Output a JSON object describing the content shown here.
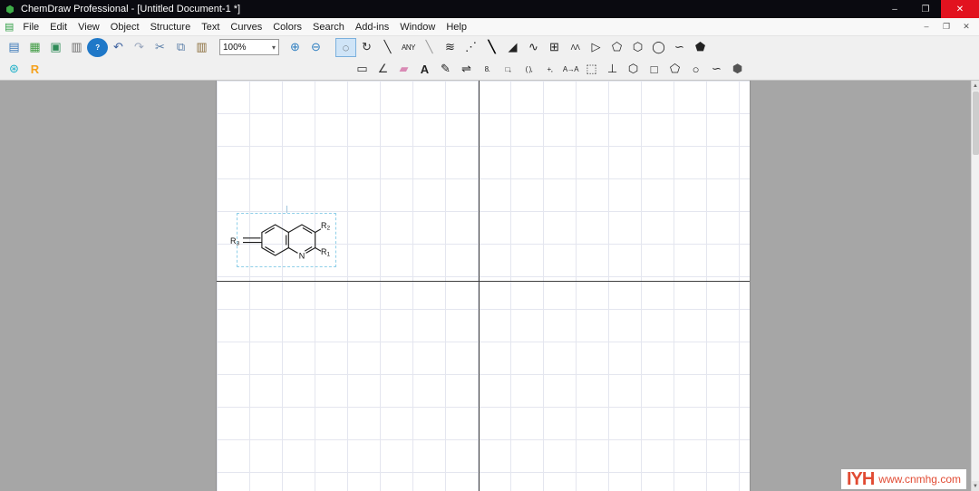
{
  "window": {
    "app_icon": "⬢",
    "title": "ChemDraw Professional - [Untitled Document-1 *]",
    "controls": {
      "minimize": "–",
      "maximize": "❐",
      "close": "✕"
    }
  },
  "menubar": {
    "doc_icon": "▤",
    "items": [
      {
        "name": "menu-file",
        "label": "File"
      },
      {
        "name": "menu-edit",
        "label": "Edit"
      },
      {
        "name": "menu-view",
        "label": "View"
      },
      {
        "name": "menu-object",
        "label": "Object"
      },
      {
        "name": "menu-structure",
        "label": "Structure"
      },
      {
        "name": "menu-text",
        "label": "Text"
      },
      {
        "name": "menu-curves",
        "label": "Curves"
      },
      {
        "name": "menu-colors",
        "label": "Colors"
      },
      {
        "name": "menu-search",
        "label": "Search"
      },
      {
        "name": "menu-addins",
        "label": "Add-ins"
      },
      {
        "name": "menu-window",
        "label": "Window"
      },
      {
        "name": "menu-help",
        "label": "Help"
      }
    ],
    "doc_controls": {
      "minimize": "–",
      "restore": "❐",
      "close": "✕"
    }
  },
  "toolbar": {
    "file_items": [
      {
        "name": "new-document-icon",
        "glyph": "▤",
        "color": "#3a77b8"
      },
      {
        "name": "open-icon",
        "glyph": "▦",
        "color": "#3f9b43"
      },
      {
        "name": "save-icon",
        "glyph": "▣",
        "color": "#2e8b57"
      },
      {
        "name": "print-icon",
        "glyph": "▥",
        "color": "#6f6f6f"
      },
      {
        "name": "help-icon",
        "glyph": "?",
        "color": "#ffffff",
        "bg": "#1f78c8",
        "small": true,
        "bold": true
      },
      {
        "name": "undo-icon",
        "glyph": "↶",
        "color": "#3a5f9e"
      },
      {
        "name": "redo-icon",
        "glyph": "↷",
        "color": "#9aa7bd"
      },
      {
        "name": "cut-icon",
        "glyph": "✂",
        "color": "#5a7ea8"
      },
      {
        "name": "copy-icon",
        "glyph": "⧉",
        "color": "#5a7ea8"
      },
      {
        "name": "paste-icon",
        "glyph": "▥",
        "color": "#8a6d3b"
      }
    ],
    "zoom": {
      "value": "100%",
      "dropdown": "▾"
    },
    "zoom_items": [
      {
        "name": "zoom-in-icon",
        "glyph": "⊕",
        "color": "#2f7fc1"
      },
      {
        "name": "zoom-out-icon",
        "glyph": "⊖",
        "color": "#2f7fc1"
      }
    ],
    "tool_items": [
      {
        "name": "lasso-tool-icon",
        "glyph": "◌",
        "color": "#333333",
        "selected": true
      },
      {
        "name": "rotate-tool-icon",
        "glyph": "↻",
        "color": "#333333"
      },
      {
        "name": "solid-bond-icon",
        "glyph": "╲",
        "color": "#222222"
      },
      {
        "name": "any-bond-icon",
        "glyph": "ANY",
        "color": "#222222",
        "small": true
      },
      {
        "name": "dashed-bond-icon",
        "glyph": "╲",
        "color": "#999999"
      },
      {
        "name": "hashed-bond-icon",
        "glyph": "≋",
        "color": "#222222"
      },
      {
        "name": "hashed-wedge-icon",
        "glyph": "⋰",
        "color": "#222222"
      },
      {
        "name": "bold-bond-icon",
        "glyph": "╲",
        "color": "#000000",
        "bold": true
      },
      {
        "name": "wedge-bond-icon",
        "glyph": "◢",
        "color": "#222222"
      },
      {
        "name": "wavy-bond-icon",
        "glyph": "∿",
        "color": "#222222"
      },
      {
        "name": "table-tool-icon",
        "glyph": "⊞",
        "color": "#222222"
      },
      {
        "name": "chain-tool-icon",
        "glyph": "ΛΛ",
        "color": "#222222",
        "small": true
      },
      {
        "name": "arrow-tool-icon",
        "glyph": "▷",
        "color": "#222222"
      },
      {
        "name": "cyclopentane-tool-icon",
        "glyph": "⬠",
        "color": "#222222"
      },
      {
        "name": "cyclohexane-tool-icon",
        "glyph": "⬡",
        "color": "#222222"
      },
      {
        "name": "benzene-tool-icon",
        "glyph": "◯",
        "color": "#222222"
      },
      {
        "name": "curved-arrow-tool-icon",
        "glyph": "∽",
        "color": "#222222"
      },
      {
        "name": "templates-tool-icon",
        "glyph": "⬟",
        "color": "#222222"
      }
    ],
    "side_items": [
      {
        "name": "addin-swirl-icon",
        "glyph": "⊛",
        "color": "#1fb0c8"
      },
      {
        "name": "r-group-icon",
        "glyph": "R",
        "color": "#f5a11c",
        "bold": true
      }
    ],
    "tool_items2": [
      {
        "name": "marquee-tool-icon",
        "glyph": "▭",
        "color": "#333333"
      },
      {
        "name": "angle-tool-icon",
        "glyph": "∠",
        "color": "#333333"
      },
      {
        "name": "eraser-tool-icon",
        "glyph": "▰",
        "color": "#d98ab5"
      },
      {
        "name": "text-tool-icon",
        "glyph": "A",
        "color": "#222222",
        "bold": true
      },
      {
        "name": "pen-tool-icon",
        "glyph": "✎",
        "color": "#222222"
      },
      {
        "name": "arrows-tool-icon",
        "glyph": "⇌",
        "color": "#222222"
      },
      {
        "name": "orbitals-tool-icon",
        "glyph": "8.",
        "color": "#222222",
        "small": true
      },
      {
        "name": "shapes-tool-icon",
        "glyph": "□,",
        "color": "#222222",
        "small": true
      },
      {
        "name": "brackets-tool-icon",
        "glyph": "( ),",
        "color": "#222222",
        "small": true
      },
      {
        "name": "plus-tool-icon",
        "glyph": "+,",
        "color": "#222222",
        "small": true
      },
      {
        "name": "reaction-map-tool-icon",
        "glyph": "A→A",
        "color": "#222222",
        "small": true
      },
      {
        "name": "frame-tool-icon",
        "glyph": "⬚",
        "color": "#222222"
      },
      {
        "name": "tlc-plate-tool-icon",
        "glyph": "⊥",
        "color": "#222222"
      },
      {
        "name": "hexagon-template-icon",
        "glyph": "⬡",
        "color": "#222222"
      },
      {
        "name": "square-template-icon",
        "glyph": "□",
        "color": "#222222"
      },
      {
        "name": "pentagon-template-icon",
        "glyph": "⬠",
        "color": "#222222"
      },
      {
        "name": "circle-template-icon",
        "glyph": "○",
        "color": "#222222"
      },
      {
        "name": "curve-template-icon",
        "glyph": "∽",
        "color": "#222222"
      },
      {
        "name": "chair-template-icon",
        "glyph": "⬢",
        "color": "#555555"
      }
    ]
  },
  "canvas": {
    "structure": {
      "atom_n": "N",
      "r1_base": "R",
      "r1_sub": "1",
      "r2_base": "R",
      "r2_sub": "2",
      "r3_base": "R",
      "r3_sub": "3"
    }
  },
  "scrollbar": {
    "up": "▲",
    "down": "▼"
  },
  "watermark": {
    "logo": "IYH",
    "text": "www.cnmhg.com",
    "color": "#e14b33"
  }
}
